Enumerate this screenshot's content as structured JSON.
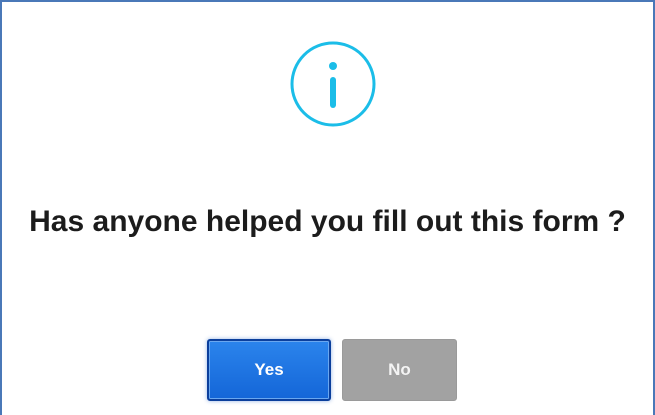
{
  "dialog": {
    "question": "Has anyone helped you fill out this form ?",
    "icon": "info-circle-icon",
    "accent_color": "#1bbde8"
  },
  "buttons": {
    "yes_label": "Yes",
    "no_label": "No",
    "yes_color": "#1466d8",
    "no_color": "#a2a2a2"
  }
}
